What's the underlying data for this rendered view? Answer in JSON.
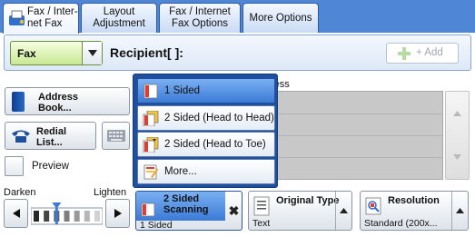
{
  "tabs": [
    {
      "label_line1": "Fax / Inter-",
      "label_line2": "net Fax",
      "active": true
    },
    {
      "label_line1": "Layout",
      "label_line2": "Adjustment",
      "active": false
    },
    {
      "label_line1": "Fax / Internet",
      "label_line2": "Fax Options",
      "active": false
    },
    {
      "label": "More Options",
      "active": false
    }
  ],
  "recipient_row": {
    "mode_select": "Fax",
    "recipient_label": "Recipient[   ]:",
    "add_button": "+ Add"
  },
  "sidebar": {
    "address_book_line1": "Address",
    "address_book_line2": "Book...",
    "redial_line1": "Redial",
    "redial_line2": "List...",
    "preview": "Preview"
  },
  "density": {
    "darken_label": "Darken",
    "lighten_label": "Lighten",
    "level": 3,
    "steps": 7
  },
  "recipient_list": {
    "header": "ress",
    "rows": 4
  },
  "sided_popup": {
    "items": [
      {
        "label": "1 Sided",
        "selected": true,
        "icon": "one-sided-icon"
      },
      {
        "label": "2 Sided (Head to Head)",
        "selected": false,
        "icon": "two-sided-head-to-head-icon"
      },
      {
        "label": "2 Sided (Head to Toe)",
        "selected": false,
        "icon": "two-sided-head-to-toe-icon"
      },
      {
        "label": "More...",
        "selected": false,
        "icon": "more-icon"
      }
    ]
  },
  "bottom_settings": {
    "sided": {
      "title_line1": "2 Sided",
      "title_line2": "Scanning",
      "value": "1 Sided"
    },
    "original_type": {
      "title": "Original Type",
      "value": "Text"
    },
    "resolution": {
      "title": "Resolution",
      "value": "Standard (200x..."
    }
  },
  "colors": {
    "accent_blue": "#3b7ad6",
    "tab_bar": "#4f86d6",
    "fax_select_green": "#c9e893"
  }
}
